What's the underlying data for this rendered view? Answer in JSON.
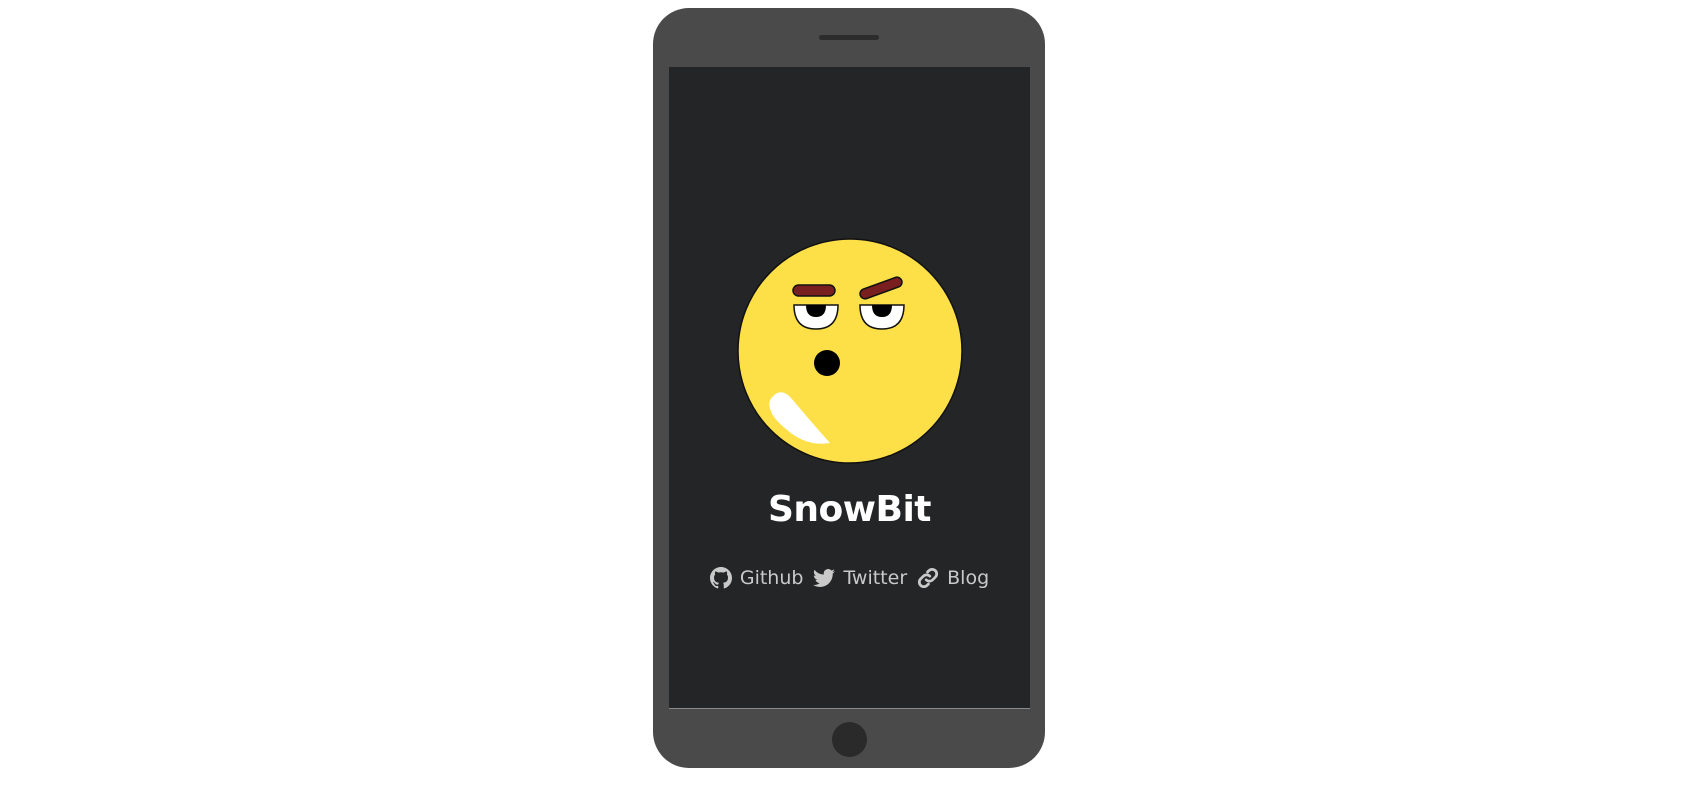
{
  "profile": {
    "name": "SnowBit",
    "avatar_icon": "sleepy-emoji-face"
  },
  "links": [
    {
      "label": "Github",
      "icon": "github-icon"
    },
    {
      "label": "Twitter",
      "icon": "twitter-icon"
    },
    {
      "label": "Blog",
      "icon": "link-icon"
    }
  ],
  "colors": {
    "page_background": "#ffffff",
    "phone_body": "#4a4a4a",
    "screen_background": "#242526",
    "face_yellow": "#fde047",
    "eyebrow_brown": "#7a1f1f",
    "link_text": "#c9c9c9",
    "name_text": "#ffffff"
  }
}
